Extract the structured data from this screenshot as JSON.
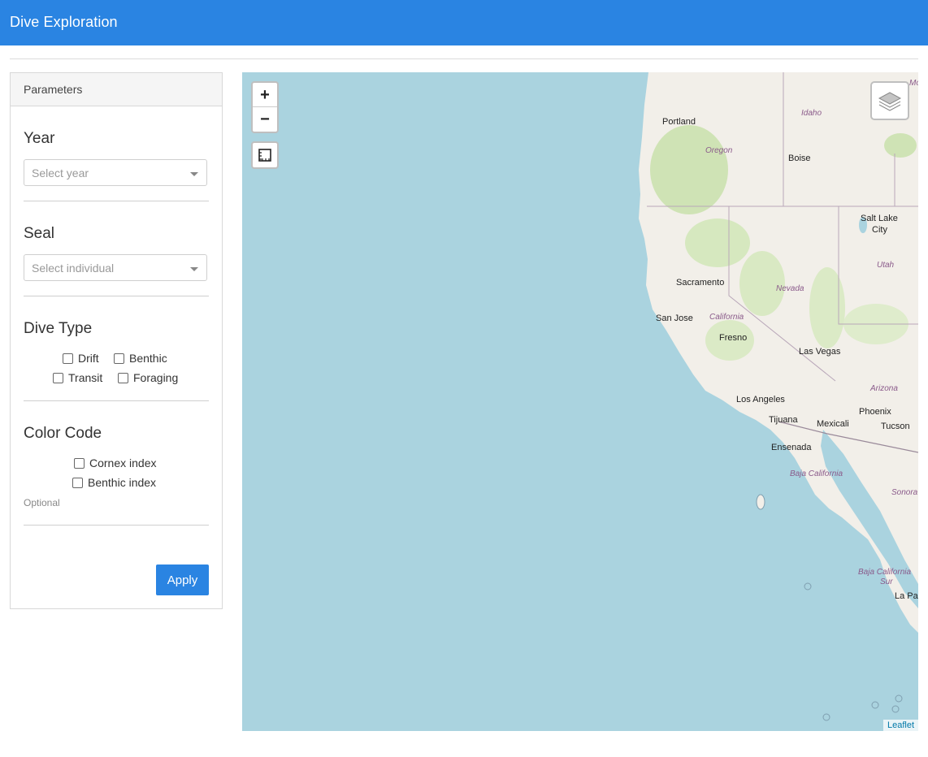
{
  "app": {
    "title": "Dive Exploration"
  },
  "sidebar": {
    "header": "Parameters",
    "year": {
      "label": "Year",
      "placeholder": "Select year"
    },
    "seal": {
      "label": "Seal",
      "placeholder": "Select individual"
    },
    "dive_type": {
      "label": "Dive Type",
      "options": [
        "Drift",
        "Benthic",
        "Transit",
        "Foraging"
      ]
    },
    "color_code": {
      "label": "Color Code",
      "options": [
        "Cornex index",
        "Benthic index"
      ],
      "hint": "Optional"
    },
    "apply_label": "Apply"
  },
  "map": {
    "zoom_in": "+",
    "zoom_out": "−",
    "attribution": "Leaflet",
    "colors": {
      "water": "#aad3df",
      "land": "#f2efe9",
      "forest": "#cfe3b5"
    },
    "labels": {
      "portland": "Portland",
      "oregon": "Oregon",
      "idaho": "Idaho",
      "boise": "Boise",
      "salt_lake": "Salt Lake",
      "city": "City",
      "utah": "Utah",
      "sacramento": "Sacramento",
      "nevada": "Nevada",
      "california": "California",
      "san_jose": "San Jose",
      "fresno": "Fresno",
      "las_vegas": "Las Vegas",
      "arizona": "Arizona",
      "los_angeles": "Los Angeles",
      "phoenix": "Phoenix",
      "tijuana": "Tijuana",
      "mexicali": "Mexicali",
      "tucson": "Tucson",
      "ensenada": "Ensenada",
      "baja_california": "Baja California",
      "sonora": "Sonora",
      "baja_california_sur_1": "Baja California",
      "baja_california_sur_2": "Sur",
      "la_paz": "La Pa",
      "mo": "Mo"
    }
  }
}
